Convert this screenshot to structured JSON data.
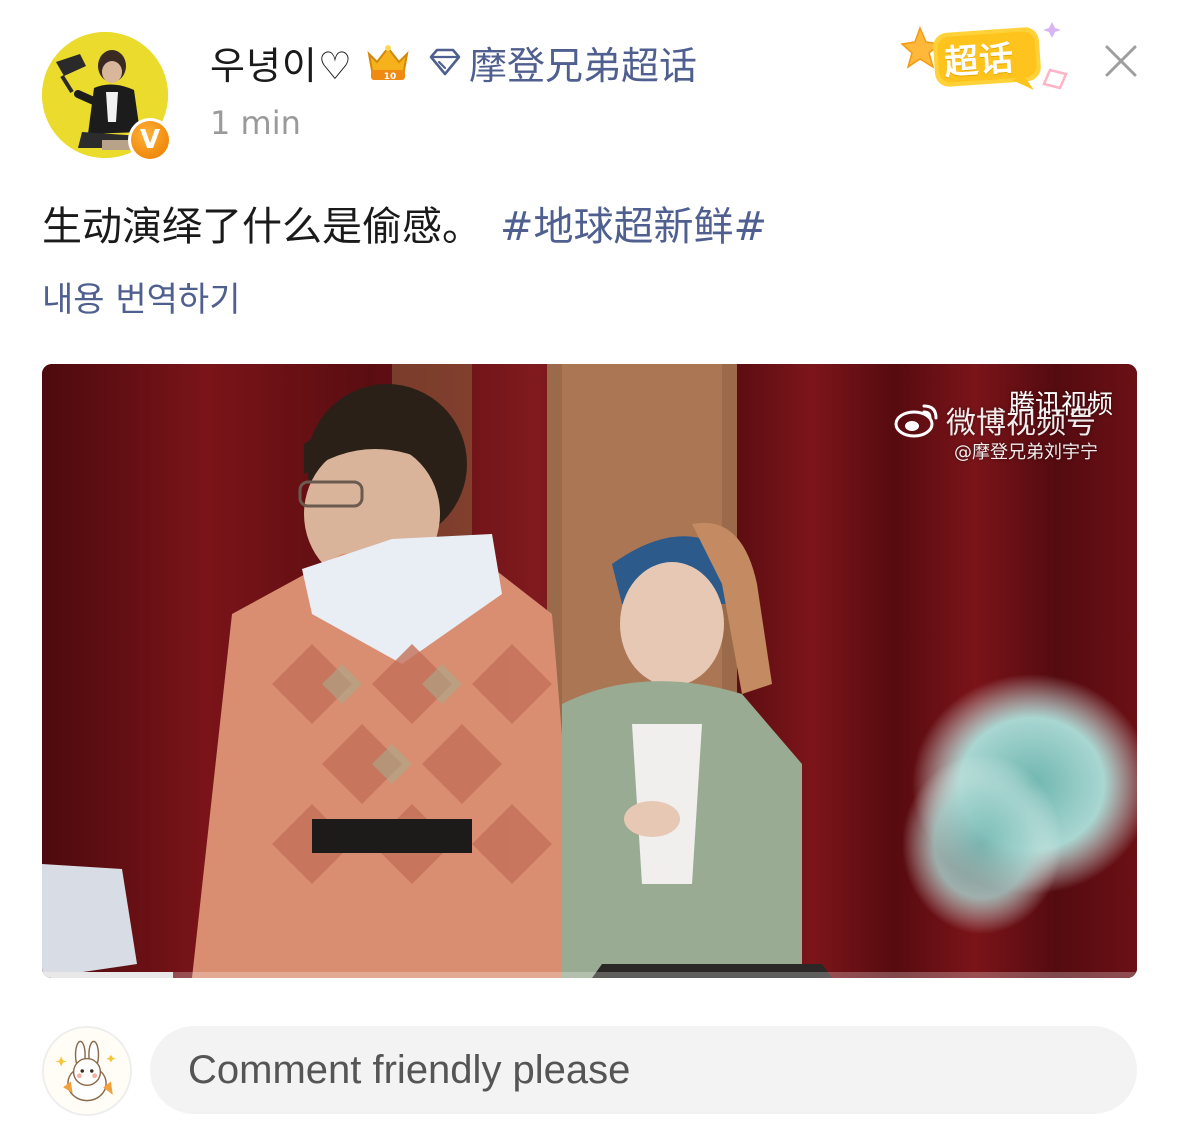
{
  "author": {
    "username": "우녕이♡",
    "timestamp": "1 min",
    "rank_badge_level": "10",
    "verified_badge": "V"
  },
  "topic": {
    "label": "摩登兄弟超话",
    "icon": "diamond-icon"
  },
  "supertopic_badge": {
    "label": "超话"
  },
  "post": {
    "text": "生动演绎了什么是偷感。",
    "hashtag": "#地球超新鲜#",
    "translate_label": "내용 번역하기"
  },
  "video": {
    "watermark_tencent": "腾讯视频",
    "watermark_weibo": "微博视频号",
    "watermark_account": "@摩登兄弟刘宇宁",
    "progress": 0.12
  },
  "comment": {
    "placeholder": "Comment friendly please"
  },
  "colors": {
    "link": "#4f5f8f",
    "timestamp": "#9a9a9a",
    "avatar_bg": "#e9d92a",
    "verified": "#f08a0c",
    "curtain": "#6b0f14"
  }
}
